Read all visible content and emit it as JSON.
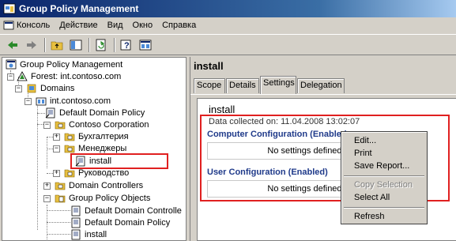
{
  "window": {
    "title": "Group Policy Management"
  },
  "menubar": [
    "Консоль",
    "Действие",
    "Вид",
    "Окно",
    "Справка"
  ],
  "tree": {
    "root": "Group Policy Management",
    "forest": "Forest: int.contoso.com",
    "domains": "Domains",
    "domain": "int.contoso.com",
    "default_domain_policy": "Default Domain Policy",
    "contoso": "Contoso Corporation",
    "buh": "Бухгалтерия",
    "managers": "Менеджеры",
    "install": "install",
    "rukovodstvo": "Руководство",
    "domain_controllers": "Domain Controllers",
    "gpo": "Group Policy Objects",
    "gpo_default_dc": "Default Domain Controlle",
    "gpo_default_domain": "Default Domain Policy",
    "gpo_install": "install"
  },
  "right": {
    "title": "install",
    "tabs": [
      "Scope",
      "Details",
      "Settings",
      "Delegation"
    ],
    "active_tab": "Settings",
    "report_title": "install",
    "data_collected": "Data collected on: 11.04.2008 13:02:07",
    "computer_config": "Computer Configuration (Enable",
    "computer_config_suffix": "d",
    "no_settings_1": "No settings defined.",
    "user_config": "User Configuration (Enabled)",
    "no_settings_2": "No settings defined."
  },
  "context_menu": {
    "items": [
      "Edit...",
      "Print",
      "Save Report...",
      "Copy Selection",
      "Select All",
      "Refresh"
    ],
    "disabled": [
      "Copy Selection"
    ]
  },
  "colors": {
    "highlight_red": "#e02020",
    "title_blue": "#0a246a",
    "link_blue": "#1f3a8a"
  }
}
